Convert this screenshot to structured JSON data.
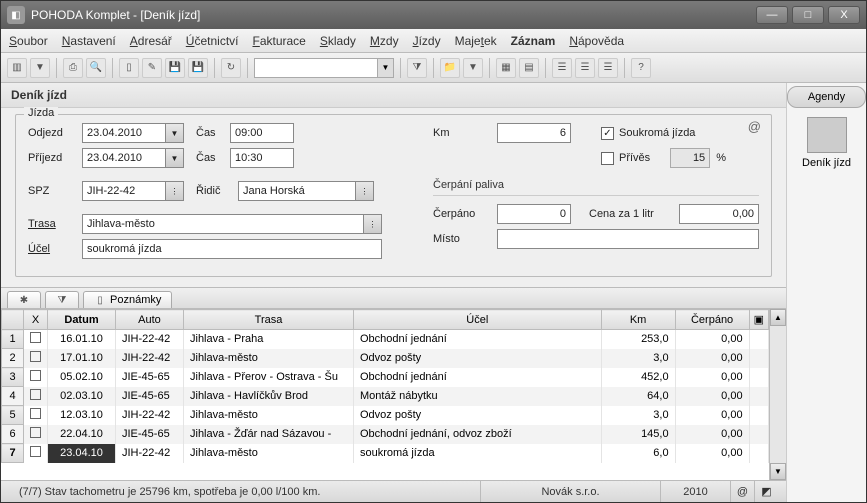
{
  "window": {
    "title": "POHODA Komplet - [Deník jízd]"
  },
  "menu": [
    "Soubor",
    "Nastavení",
    "Adresář",
    "Účetnictví",
    "Fakturace",
    "Sklady",
    "Mzdy",
    "Jízdy",
    "Majetek",
    "Záznam",
    "Nápověda"
  ],
  "menu_underline_idx": [
    0,
    0,
    0,
    0,
    0,
    0,
    0,
    0,
    4,
    -1,
    0
  ],
  "menu_bold": [
    false,
    false,
    false,
    false,
    false,
    false,
    false,
    false,
    false,
    true,
    false
  ],
  "side": {
    "header": "Agendy",
    "label": "Deník jízd"
  },
  "section_title": "Deník jízd",
  "form": {
    "legend": "Jízda",
    "odjezd_lbl": "Odjezd",
    "odjezd_date": "23.04.2010",
    "odjezd_cas_lbl": "Čas",
    "odjezd_cas": "09:00",
    "prijezd_lbl": "Příjezd",
    "prijezd_date": "23.04.2010",
    "prijezd_cas_lbl": "Čas",
    "prijezd_cas": "10:30",
    "spz_lbl": "SPZ",
    "spz": "JIH-22-42",
    "ridic_lbl": "Řidič",
    "ridic": "Jana Horská",
    "trasa_lbl": "Trasa",
    "trasa": "Jihlava-město",
    "ucel_lbl": "Účel",
    "ucel": "soukromá jízda",
    "km_lbl": "Km",
    "km": "6",
    "soukroma_lbl": "Soukromá jízda",
    "prives_lbl": "Přívěs",
    "prives_pct": "15",
    "pct": "%",
    "cerpani_hdr": "Čerpání paliva",
    "cerpano_lbl": "Čerpáno",
    "cerpano": "0",
    "cena_lbl": "Cena za 1 litr",
    "cena": "0,00",
    "misto_lbl": "Místo",
    "misto": ""
  },
  "tabs": {
    "notes": "Poznámky"
  },
  "grid": {
    "headers": {
      "x": "X",
      "datum": "Datum",
      "auto": "Auto",
      "trasa": "Trasa",
      "ucel": "Účel",
      "km": "Km",
      "cerpano": "Čerpáno"
    },
    "rows": [
      {
        "n": "1",
        "datum": "16.01.10",
        "auto": "JIH-22-42",
        "trasa": "Jihlava - Praha",
        "ucel": "Obchodní jednání",
        "km": "253,0",
        "cerpano": "0,00"
      },
      {
        "n": "2",
        "datum": "17.01.10",
        "auto": "JIH-22-42",
        "trasa": "Jihlava-město",
        "ucel": "Odvoz pošty",
        "km": "3,0",
        "cerpano": "0,00"
      },
      {
        "n": "3",
        "datum": "05.02.10",
        "auto": "JIE-45-65",
        "trasa": "Jihlava - Přerov - Ostrava - Šu",
        "ucel": "Obchodní jednání",
        "km": "452,0",
        "cerpano": "0,00"
      },
      {
        "n": "4",
        "datum": "02.03.10",
        "auto": "JIE-45-65",
        "trasa": "Jihlava - Havlíčkův Brod",
        "ucel": "Montáž nábytku",
        "km": "64,0",
        "cerpano": "0,00"
      },
      {
        "n": "5",
        "datum": "12.03.10",
        "auto": "JIH-22-42",
        "trasa": "Jihlava-město",
        "ucel": "Odvoz pošty",
        "km": "3,0",
        "cerpano": "0,00"
      },
      {
        "n": "6",
        "datum": "22.04.10",
        "auto": "JIE-45-65",
        "trasa": "Jihlava - Žďár nad Sázavou -",
        "ucel": "Obchodní jednání, odvoz zboží",
        "km": "145,0",
        "cerpano": "0,00"
      },
      {
        "n": "7",
        "datum": "23.04.10",
        "auto": "JIH-22-42",
        "trasa": "Jihlava-město",
        "ucel": "soukromá jízda",
        "km": "6,0",
        "cerpano": "0,00"
      }
    ]
  },
  "status": {
    "left": "(7/7) Stav tachometru je 25796 km, spotřeba je 0,00 l/100 km.",
    "company": "Novák  s.r.o.",
    "year": "2010"
  }
}
